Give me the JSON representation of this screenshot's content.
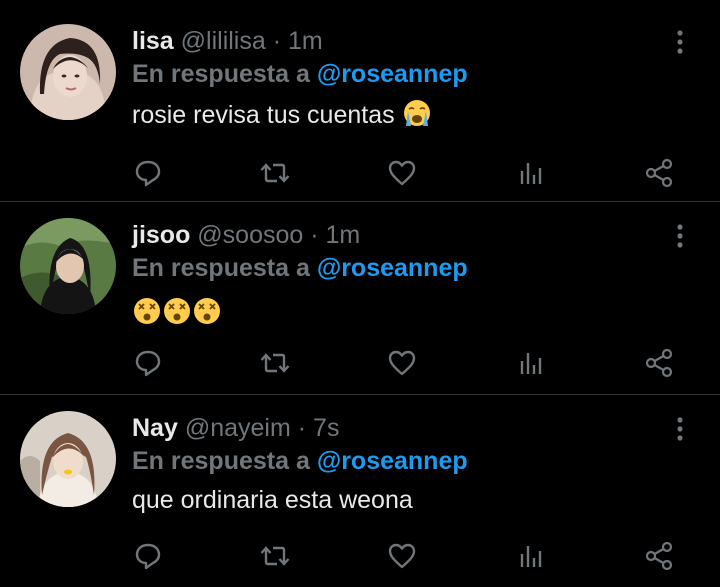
{
  "tweets": [
    {
      "name": "lisa",
      "handle": "@lililisa",
      "time": "1m",
      "reply_prefix": "En respuesta a",
      "reply_to": "@roseannep",
      "text": "rosie revisa tus cuentas",
      "emojis": [
        "loudly-crying-face"
      ],
      "avatar_palette": [
        "#c9b3aa",
        "#3a2a26",
        "#e8d8d0"
      ]
    },
    {
      "name": "jisoo",
      "handle": "@soosoo",
      "time": "1m",
      "reply_prefix": "En respuesta a",
      "reply_to": "@roseannep",
      "text": "",
      "emojis": [
        "dizzy-face",
        "dizzy-face",
        "dizzy-face"
      ],
      "avatar_palette": [
        "#4d6b3a",
        "#1a1a1a",
        "#c8a890"
      ]
    },
    {
      "name": "Nay",
      "handle": "@nayeim",
      "time": "7s",
      "reply_prefix": "En respuesta a",
      "reply_to": "@roseannep",
      "text": "que ordinaria esta weona",
      "emojis": [],
      "avatar_palette": [
        "#d8cfc4",
        "#6a4a3a",
        "#f2e4d8"
      ]
    }
  ],
  "colors": {
    "background": "#000000",
    "text": "#e7e9ea",
    "muted": "#71767b",
    "link": "#1d9bf0",
    "divider": "#2f3336"
  },
  "actions": [
    "reply-icon",
    "retweet-icon",
    "like-icon",
    "analytics-icon",
    "share-icon"
  ]
}
